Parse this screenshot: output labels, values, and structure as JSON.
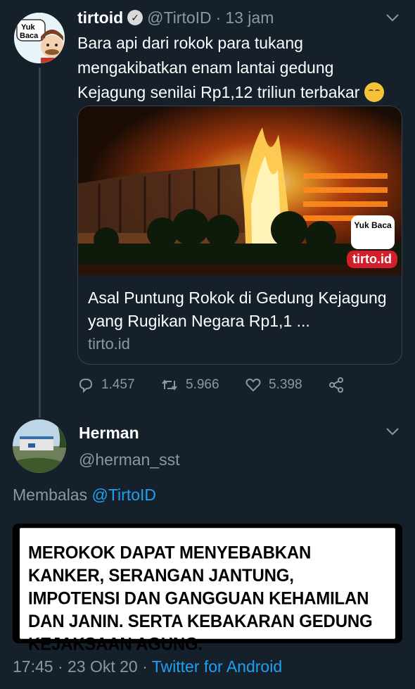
{
  "tweet": {
    "author_name": "tirtoid",
    "handle": "@TirtoID",
    "separator": "·",
    "time": "13 jam",
    "text": "Bara api dari rokok para tukang mengakibatkan enam lantai gedung Kejagung senilai Rp1,12 triliun terbakar",
    "avatar_text": "Yuk Baca",
    "card": {
      "title": "Asal Puntung Rokok di Gedung Kejagung yang Rugikan Negara Rp1,1 ...",
      "domain": "tirto.id",
      "badge_text": "Yuk Baca",
      "logo_text": "tirto.id"
    },
    "stats": {
      "replies": "1.457",
      "retweets": "5.966",
      "likes": "5.398"
    }
  },
  "reply": {
    "author_name": "Herman",
    "handle": "@herman_sst",
    "replying_prefix": "Membalas",
    "replying_to": "@TirtoID",
    "image_text": "MEROKOK DAPAT MENYEBABKAN KANKER, SERANGAN JANTUNG, IMPOTENSI DAN GANGGUAN KEHAMILAN DAN JANIN. SERTA KEBAKARAN GEDUNG KEJAKSAAN AGUNG.",
    "timestamp": "17:45 · 23 Okt 20 · ",
    "source": "Twitter for Android"
  },
  "colors": {
    "background": "#15202b",
    "secondary_text": "#8899a6",
    "link": "#1da1f2",
    "divider": "#38444d"
  },
  "icons": [
    "verified-icon",
    "chevron-down-icon",
    "reply-icon",
    "retweet-icon",
    "like-icon",
    "share-icon"
  ]
}
